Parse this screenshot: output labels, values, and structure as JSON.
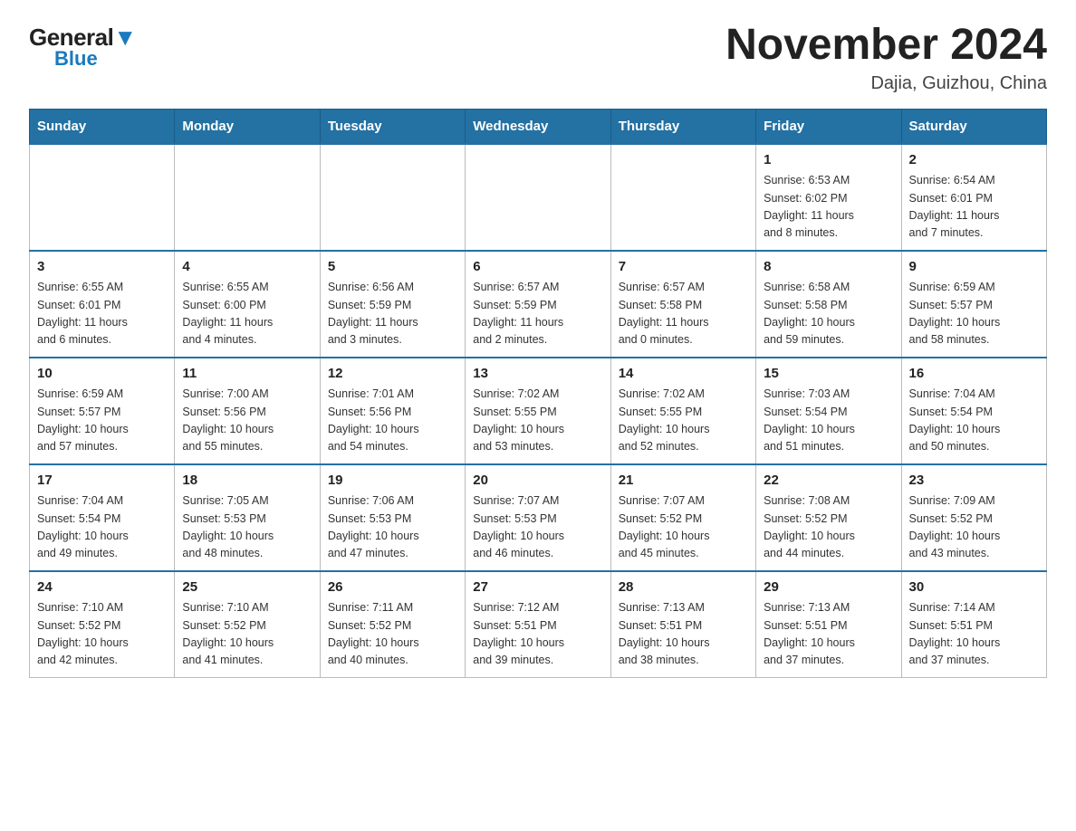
{
  "header": {
    "logo_general": "General",
    "logo_blue": "Blue",
    "title": "November 2024",
    "location": "Dajia, Guizhou, China"
  },
  "weekdays": [
    "Sunday",
    "Monday",
    "Tuesday",
    "Wednesday",
    "Thursday",
    "Friday",
    "Saturday"
  ],
  "weeks": [
    [
      {
        "day": "",
        "info": ""
      },
      {
        "day": "",
        "info": ""
      },
      {
        "day": "",
        "info": ""
      },
      {
        "day": "",
        "info": ""
      },
      {
        "day": "",
        "info": ""
      },
      {
        "day": "1",
        "info": "Sunrise: 6:53 AM\nSunset: 6:02 PM\nDaylight: 11 hours\nand 8 minutes."
      },
      {
        "day": "2",
        "info": "Sunrise: 6:54 AM\nSunset: 6:01 PM\nDaylight: 11 hours\nand 7 minutes."
      }
    ],
    [
      {
        "day": "3",
        "info": "Sunrise: 6:55 AM\nSunset: 6:01 PM\nDaylight: 11 hours\nand 6 minutes."
      },
      {
        "day": "4",
        "info": "Sunrise: 6:55 AM\nSunset: 6:00 PM\nDaylight: 11 hours\nand 4 minutes."
      },
      {
        "day": "5",
        "info": "Sunrise: 6:56 AM\nSunset: 5:59 PM\nDaylight: 11 hours\nand 3 minutes."
      },
      {
        "day": "6",
        "info": "Sunrise: 6:57 AM\nSunset: 5:59 PM\nDaylight: 11 hours\nand 2 minutes."
      },
      {
        "day": "7",
        "info": "Sunrise: 6:57 AM\nSunset: 5:58 PM\nDaylight: 11 hours\nand 0 minutes."
      },
      {
        "day": "8",
        "info": "Sunrise: 6:58 AM\nSunset: 5:58 PM\nDaylight: 10 hours\nand 59 minutes."
      },
      {
        "day": "9",
        "info": "Sunrise: 6:59 AM\nSunset: 5:57 PM\nDaylight: 10 hours\nand 58 minutes."
      }
    ],
    [
      {
        "day": "10",
        "info": "Sunrise: 6:59 AM\nSunset: 5:57 PM\nDaylight: 10 hours\nand 57 minutes."
      },
      {
        "day": "11",
        "info": "Sunrise: 7:00 AM\nSunset: 5:56 PM\nDaylight: 10 hours\nand 55 minutes."
      },
      {
        "day": "12",
        "info": "Sunrise: 7:01 AM\nSunset: 5:56 PM\nDaylight: 10 hours\nand 54 minutes."
      },
      {
        "day": "13",
        "info": "Sunrise: 7:02 AM\nSunset: 5:55 PM\nDaylight: 10 hours\nand 53 minutes."
      },
      {
        "day": "14",
        "info": "Sunrise: 7:02 AM\nSunset: 5:55 PM\nDaylight: 10 hours\nand 52 minutes."
      },
      {
        "day": "15",
        "info": "Sunrise: 7:03 AM\nSunset: 5:54 PM\nDaylight: 10 hours\nand 51 minutes."
      },
      {
        "day": "16",
        "info": "Sunrise: 7:04 AM\nSunset: 5:54 PM\nDaylight: 10 hours\nand 50 minutes."
      }
    ],
    [
      {
        "day": "17",
        "info": "Sunrise: 7:04 AM\nSunset: 5:54 PM\nDaylight: 10 hours\nand 49 minutes."
      },
      {
        "day": "18",
        "info": "Sunrise: 7:05 AM\nSunset: 5:53 PM\nDaylight: 10 hours\nand 48 minutes."
      },
      {
        "day": "19",
        "info": "Sunrise: 7:06 AM\nSunset: 5:53 PM\nDaylight: 10 hours\nand 47 minutes."
      },
      {
        "day": "20",
        "info": "Sunrise: 7:07 AM\nSunset: 5:53 PM\nDaylight: 10 hours\nand 46 minutes."
      },
      {
        "day": "21",
        "info": "Sunrise: 7:07 AM\nSunset: 5:52 PM\nDaylight: 10 hours\nand 45 minutes."
      },
      {
        "day": "22",
        "info": "Sunrise: 7:08 AM\nSunset: 5:52 PM\nDaylight: 10 hours\nand 44 minutes."
      },
      {
        "day": "23",
        "info": "Sunrise: 7:09 AM\nSunset: 5:52 PM\nDaylight: 10 hours\nand 43 minutes."
      }
    ],
    [
      {
        "day": "24",
        "info": "Sunrise: 7:10 AM\nSunset: 5:52 PM\nDaylight: 10 hours\nand 42 minutes."
      },
      {
        "day": "25",
        "info": "Sunrise: 7:10 AM\nSunset: 5:52 PM\nDaylight: 10 hours\nand 41 minutes."
      },
      {
        "day": "26",
        "info": "Sunrise: 7:11 AM\nSunset: 5:52 PM\nDaylight: 10 hours\nand 40 minutes."
      },
      {
        "day": "27",
        "info": "Sunrise: 7:12 AM\nSunset: 5:51 PM\nDaylight: 10 hours\nand 39 minutes."
      },
      {
        "day": "28",
        "info": "Sunrise: 7:13 AM\nSunset: 5:51 PM\nDaylight: 10 hours\nand 38 minutes."
      },
      {
        "day": "29",
        "info": "Sunrise: 7:13 AM\nSunset: 5:51 PM\nDaylight: 10 hours\nand 37 minutes."
      },
      {
        "day": "30",
        "info": "Sunrise: 7:14 AM\nSunset: 5:51 PM\nDaylight: 10 hours\nand 37 minutes."
      }
    ]
  ]
}
